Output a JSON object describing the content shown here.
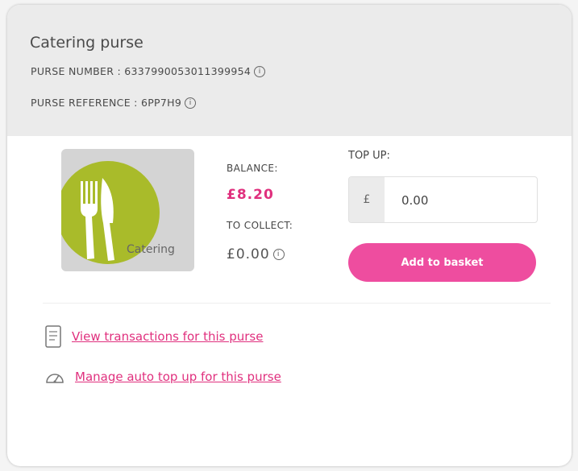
{
  "purse": {
    "title": "Catering purse",
    "number_label": "PURSE NUMBER : 6337990053011399954",
    "reference_label": "PURSE REFERENCE : 6PP7H9",
    "info_glyph": "i",
    "image_label": "Catering",
    "image_icon": "knife-fork-icon",
    "balance_label": "BALANCE:",
    "balance_value": "£8.20",
    "to_collect_label": "TO COLLECT:",
    "to_collect_value": "£0.00"
  },
  "topup": {
    "label": "TOP UP:",
    "currency_symbol": "£",
    "amount_value": "0.00",
    "add_button_label": "Add to basket"
  },
  "links": {
    "view_transactions": "View transactions for this purse",
    "view_transactions_icon": "receipt-icon",
    "manage_auto_topup": "Manage auto top up for this purse",
    "manage_auto_topup_icon": "gauge-icon"
  },
  "colors": {
    "accent_pink": "#e0307e",
    "button_pink": "#ee4d9f",
    "catering_green": "#a9bb2a",
    "header_grey": "#ebebeb"
  }
}
